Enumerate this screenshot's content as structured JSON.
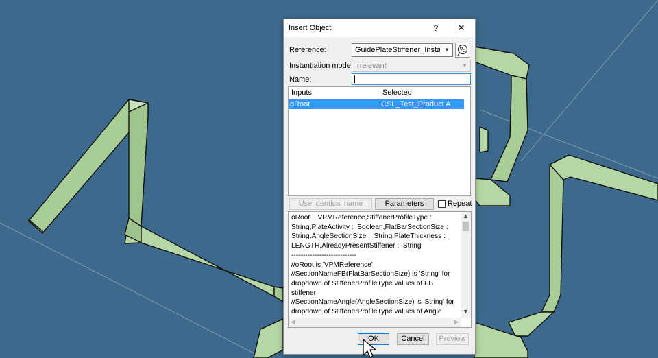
{
  "dialog": {
    "title": "Insert Object",
    "help": "?",
    "close": "✕",
    "reference_label": "Reference:",
    "reference_value": "GuidePlateStiffener_Instantiation",
    "instantiation_label": "Instantiation mode:",
    "instantiation_value": "Irrelevant",
    "name_label": "Name:",
    "name_value": "",
    "table": {
      "col_inputs": "Inputs",
      "col_selected": "Selected",
      "rows": [
        {
          "input": "oRoot",
          "selected": "CSL_Test_Product A"
        }
      ]
    },
    "use_identical_label": "Use identical name",
    "parameters_label": "Parameters",
    "repeat_label": "Repeat",
    "notes": "oRoot :  VPMReference,StiffenerProfileType :\nString,PlateActivity :  Boolean,FlatBarSectionSize :\nString,AngleSectionSize :  String,PlateThickness :\nLENGTH,AlreadyPresentStiffener :  String\n----------------------------\n//oRoot is 'VPMReference'\n//SectionNameFB(FlatBarSectionSize) is 'String' for\ndropdown of StiffenerProfileType values of FB\nstiffener\n//SectionNameAngle(AngleSectionSize) is 'String' for\ndropdown of StiffenerProfileType values of Angle\nstiffener",
    "ok_label": "OK",
    "cancel_label": "Cancel",
    "preview_label": "Preview"
  },
  "colors": {
    "background": "#3d6a8c",
    "stiffener": "#b5d6a5",
    "selection": "#3399ff"
  }
}
